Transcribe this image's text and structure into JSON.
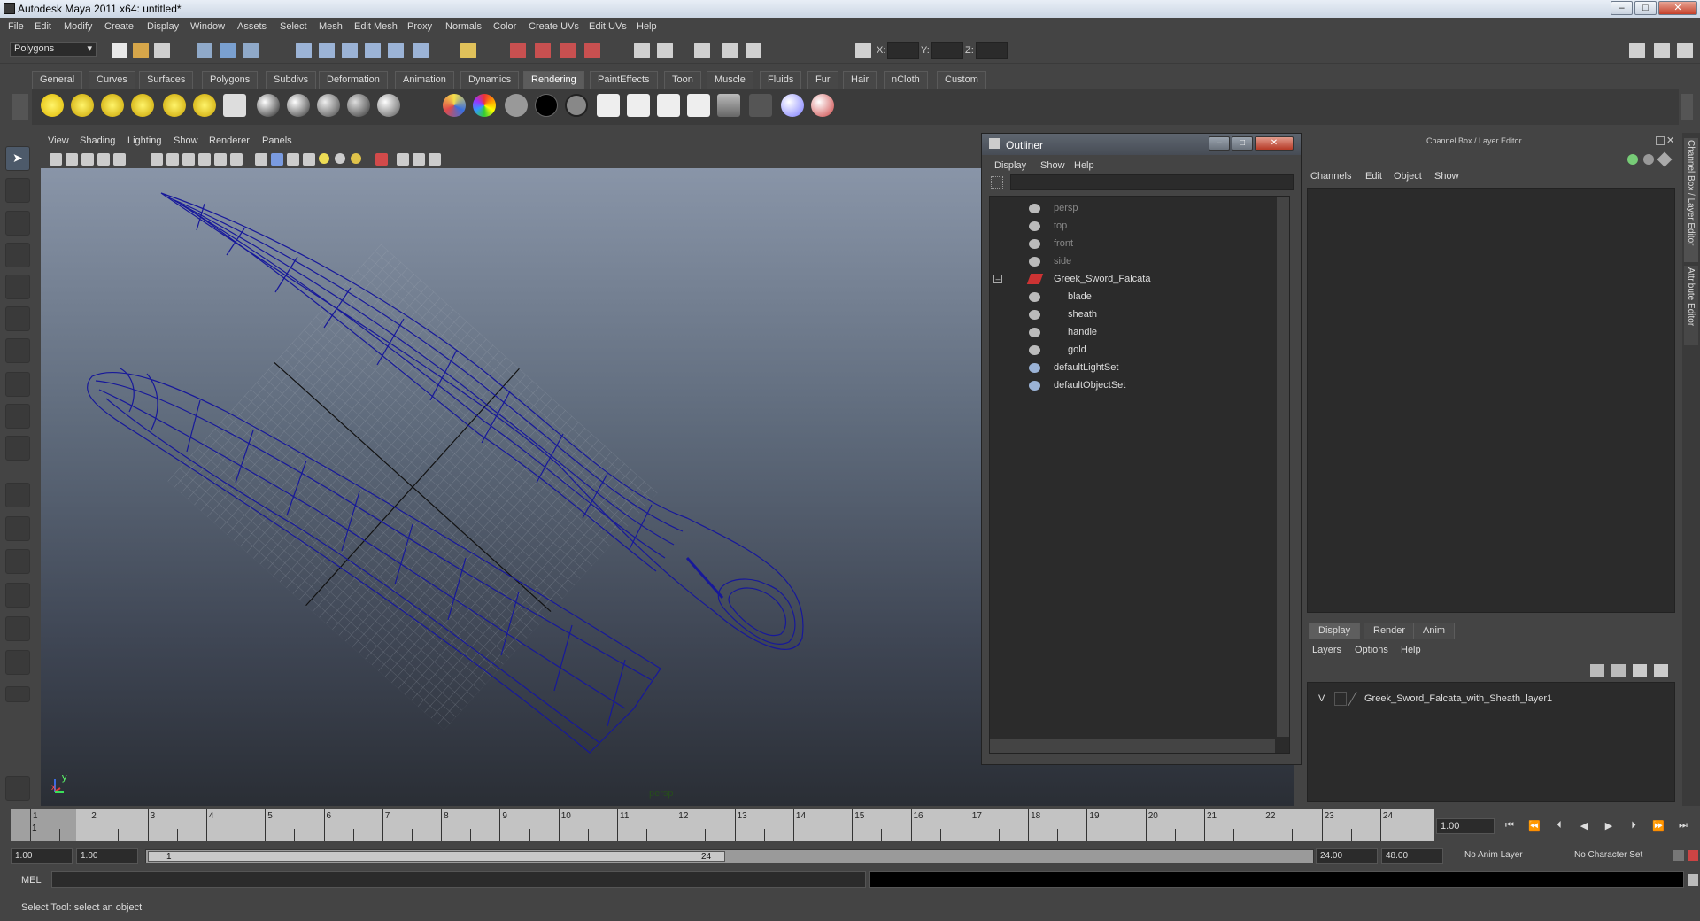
{
  "window": {
    "title": "Autodesk Maya 2011 x64: untitled*"
  },
  "menubar": [
    "File",
    "Edit",
    "Modify",
    "Create",
    "Display",
    "Window",
    "Assets",
    "Select",
    "Mesh",
    "Edit Mesh",
    "Proxy",
    "Normals",
    "Color",
    "Create UVs",
    "Edit UVs",
    "Help"
  ],
  "toolbar": {
    "mode": "Polygons",
    "x_label": "X:",
    "y_label": "Y:",
    "z_label": "Z:"
  },
  "shelf_tabs": [
    "General",
    "Curves",
    "Surfaces",
    "Polygons",
    "Subdivs",
    "Deformation",
    "Animation",
    "Dynamics",
    "Rendering",
    "PaintEffects",
    "Toon",
    "Muscle",
    "Fluids",
    "Fur",
    "Hair",
    "nCloth",
    "Custom"
  ],
  "shelf_active": "Rendering",
  "viewport": {
    "menu": [
      "View",
      "Shading",
      "Lighting",
      "Show",
      "Renderer",
      "Panels"
    ],
    "camera_label": "persp",
    "axis_x": "x",
    "axis_y": "y"
  },
  "outliner": {
    "title": "Outliner",
    "menu": [
      "Display",
      "Show",
      "Help"
    ],
    "items": [
      {
        "label": "persp",
        "dim": true
      },
      {
        "label": "top",
        "dim": true
      },
      {
        "label": "front",
        "dim": true
      },
      {
        "label": "side",
        "dim": true
      },
      {
        "label": "Greek_Sword_Falcata",
        "dim": false
      },
      {
        "label": "blade",
        "dim": false
      },
      {
        "label": "sheath",
        "dim": false
      },
      {
        "label": "handle",
        "dim": false
      },
      {
        "label": "gold",
        "dim": false
      },
      {
        "label": "defaultLightSet",
        "dim": false
      },
      {
        "label": "defaultObjectSet",
        "dim": false
      }
    ]
  },
  "channel_box": {
    "title": "Channel Box / Layer Editor",
    "menu": [
      "Channels",
      "Edit",
      "Object",
      "Show"
    ],
    "layer_tabs": [
      "Display",
      "Render",
      "Anim"
    ],
    "layer_active": "Display",
    "layer_menu": [
      "Layers",
      "Options",
      "Help"
    ],
    "layer_visible": "V",
    "layer_name": "Greek_Sword_Falcata_with_Sheath_layer1",
    "side_tabs": [
      "Channel Box / Layer Editor",
      "Attribute Editor"
    ]
  },
  "timeline": {
    "ticks": [
      "1",
      "2",
      "3",
      "4",
      "5",
      "6",
      "7",
      "8",
      "9",
      "10",
      "11",
      "12",
      "13",
      "14",
      "15",
      "16",
      "17",
      "18",
      "19",
      "20",
      "21",
      "22",
      "23",
      "24"
    ],
    "current_marker": "1",
    "current_time": "1.00"
  },
  "range": {
    "start_time": "1.00",
    "playback_start": "1.00",
    "slider_start": "1",
    "slider_end": "24",
    "playback_end": "24.00",
    "end_time": "48.00",
    "anim_layer": "No Anim Layer",
    "character_set": "No Character Set"
  },
  "command": {
    "label": "MEL"
  },
  "help_line": "Select Tool: select an object"
}
